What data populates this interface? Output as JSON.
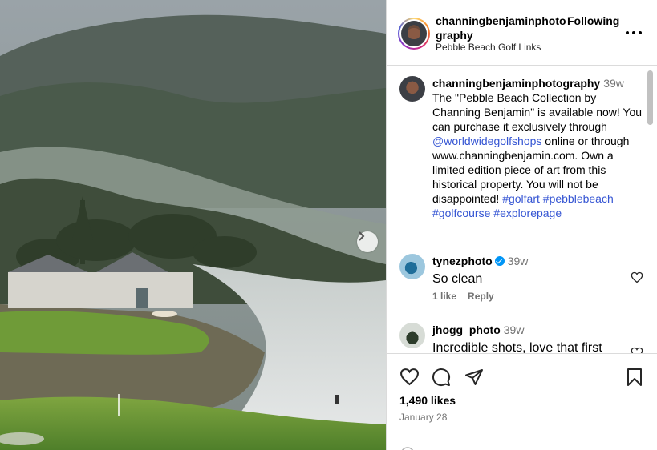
{
  "post": {
    "username": "channingbenjaminphotography",
    "follow_label": "Following",
    "location": "Pebble Beach Golf Links",
    "caption": {
      "username": "channingbenjaminphotography",
      "time": "39w",
      "text_1": "The \"Pebble Beach Collection by Channing Benjamin\" is available now! You can purchase it exclusively through ",
      "mention": "@worldwidegolfshops",
      "text_2": " online or through www.channingbenjamin.com. Own a limited edition piece of art from this historical property. You will not be disappointed! ",
      "hashtags": [
        "#golfart",
        "#pebblebeach",
        "#golfcourse",
        "#explorepage"
      ]
    },
    "comments": [
      {
        "username": "tynezphoto",
        "verified": true,
        "time": "39w",
        "text": "So clean",
        "likes": "1 like",
        "reply": "Reply"
      },
      {
        "username": "jhogg_photo",
        "verified": false,
        "time": "39w",
        "text": "Incredible shots, love that first"
      }
    ],
    "likes": "1,490 likes",
    "date": "January 28"
  },
  "icons": {
    "like": "heart-icon",
    "comment": "comment-icon",
    "share": "paper-plane-icon",
    "save": "bookmark-icon",
    "more": "more-options-icon",
    "next": "chevron-right-icon"
  },
  "colors": {
    "link": "#00376b",
    "hashtag": "#3555d3",
    "verified": "#0095f6",
    "muted": "#737373"
  }
}
